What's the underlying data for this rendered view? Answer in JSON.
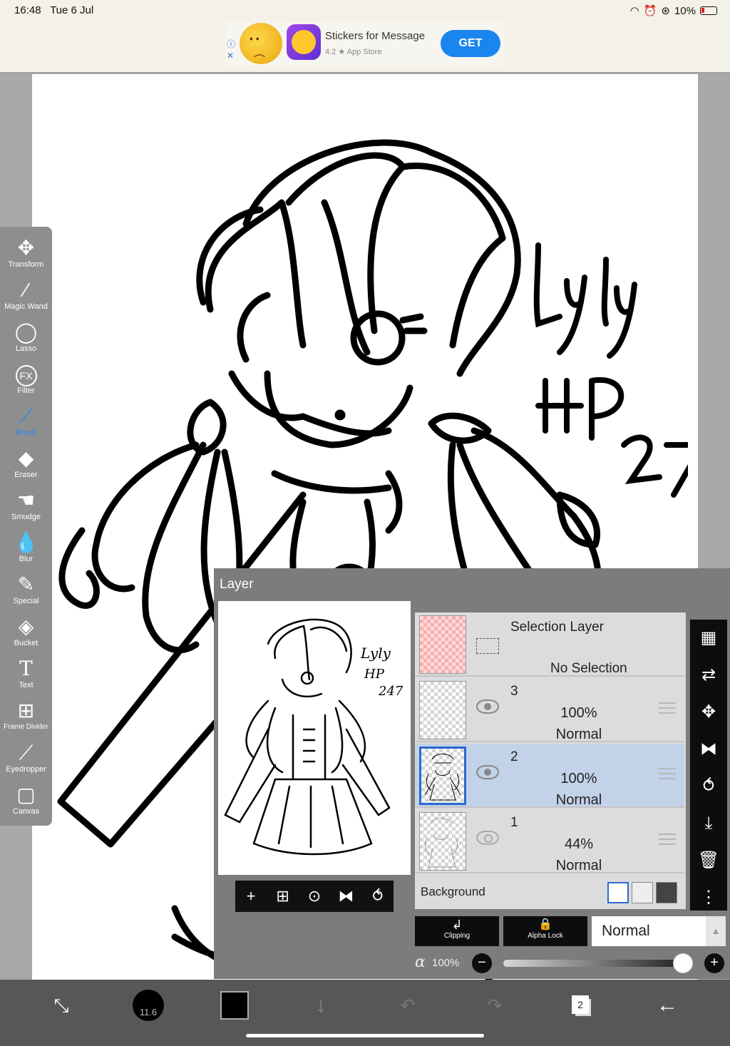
{
  "status": {
    "time": "16:48",
    "date": "Tue 6 Jul",
    "battery": "10%"
  },
  "ad": {
    "title": "Stickers for Message",
    "rating": "4.2 ★ App Store",
    "cta": "GET"
  },
  "canvas": {
    "signature_lines": [
      "Lyly",
      "HP",
      "247"
    ]
  },
  "toolbar": {
    "items": [
      {
        "label": "Transform",
        "icon": "move-icon"
      },
      {
        "label": "Magic Wand",
        "icon": "magic-wand-icon"
      },
      {
        "label": "Lasso",
        "icon": "lasso-icon"
      },
      {
        "label": "Filter",
        "icon": "fx-icon",
        "glyph": "FX"
      },
      {
        "label": "Brush",
        "icon": "brush-icon",
        "active": true
      },
      {
        "label": "Eraser",
        "icon": "eraser-icon"
      },
      {
        "label": "Smudge",
        "icon": "smudge-icon"
      },
      {
        "label": "Blur",
        "icon": "blur-drop-icon"
      },
      {
        "label": "Special",
        "icon": "special-pen-icon"
      },
      {
        "label": "Bucket",
        "icon": "bucket-icon"
      },
      {
        "label": "Text",
        "icon": "text-icon",
        "glyph": "T"
      },
      {
        "label": "Frame Divider",
        "icon": "frame-divider-icon"
      },
      {
        "label": "Eyedropper",
        "icon": "eyedropper-icon"
      },
      {
        "label": "Canvas",
        "icon": "canvas-icon"
      }
    ]
  },
  "layer_panel": {
    "title": "Layer",
    "selection_layer": {
      "name": "Selection Layer",
      "status": "No Selection"
    },
    "layers": [
      {
        "name": "3",
        "opacity": "100%",
        "mode": "Normal",
        "visible": true,
        "selected": false
      },
      {
        "name": "2",
        "opacity": "100%",
        "mode": "Normal",
        "visible": true,
        "selected": true
      },
      {
        "name": "1",
        "opacity": "44%",
        "mode": "Normal",
        "visible": true,
        "selected": false
      }
    ],
    "background_label": "Background",
    "clipping_label": "Clipping",
    "alpha_lock_label": "Alpha Lock",
    "blend_mode": "Normal",
    "alpha_symbol": "α",
    "alpha_value": "100%",
    "alpha_fraction": 1.0
  },
  "bottom_bar": {
    "brush_size": "11.6",
    "layer_count": "2"
  },
  "colors": {
    "accent": "#2a8af0",
    "selected_row": "#c2d2e9",
    "ad_button": "#1a84ef"
  }
}
